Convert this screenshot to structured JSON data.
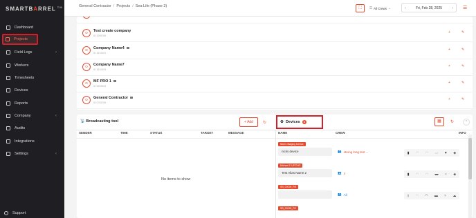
{
  "brand": {
    "part1": "SMART",
    "part2": "B",
    "o": "A",
    "part3": "RREL",
    "tm": "TM"
  },
  "sidebar": {
    "items": [
      {
        "label": "Dashboard",
        "icon": "dashboard-icon"
      },
      {
        "label": "Projects",
        "icon": "projects-icon",
        "active": true
      },
      {
        "label": "Field Logs",
        "icon": "field-logs-icon",
        "chevron": "‹"
      },
      {
        "label": "Workers",
        "icon": "workers-icon"
      },
      {
        "label": "Timesheets",
        "icon": "timesheets-icon"
      },
      {
        "label": "Devices",
        "icon": "devices-icon"
      },
      {
        "label": "Reports",
        "icon": "reports-icon"
      },
      {
        "label": "Company",
        "icon": "company-icon",
        "chevron": "‹"
      },
      {
        "label": "Audits",
        "icon": "audits-icon"
      },
      {
        "label": "Integrations",
        "icon": "integrations-icon"
      },
      {
        "label": "Settings",
        "icon": "settings-icon",
        "chevron": "‹"
      }
    ],
    "support": "Support"
  },
  "topbar": {
    "crumb1": "General Contractor",
    "crumb2": "Projects",
    "crumb3": "Sea Life (Phase 3)",
    "sep": "/",
    "crew_select": "All Crews",
    "date": "Fri, Feb 28, 2025"
  },
  "companies": [
    {
      "name": "Test create company",
      "sub": "ID 2005789"
    },
    {
      "name": "Company Name4",
      "sub": "ID 1512491"
    },
    {
      "name": "Company Name7",
      "sub": "ID 1512493"
    },
    {
      "name": "MF PRO 1",
      "sub": "ID 0002003"
    },
    {
      "name": "General Contractor",
      "sub": "ID 0703789"
    }
  ],
  "broadcast": {
    "title": "Broadcasting tool",
    "add": "+ Add",
    "columns": [
      "SENDER",
      "TIME",
      "STATUS",
      "TARGET",
      "MESSAGE"
    ],
    "empty": "No items to show"
  },
  "devices": {
    "title": "Devices",
    "count": "8",
    "columns": [
      "NAME",
      "CREW",
      "INFO"
    ],
    "rows": [
      {
        "tag": "Nick's Staging Device",
        "name": "nicks device",
        "crew": "strong long test ..."
      },
      {
        "tag": "Michael F UPITHO",
        "name": "Test Alias Name 2",
        "crew": "4"
      },
      {
        "tag": "SB_00026_RS",
        "name": "",
        "crew": "All",
        "crew_blue": true
      },
      {
        "tag": "SB_00026_R2",
        "name": "",
        "crew": ""
      }
    ]
  },
  "colors": {
    "accent": "#e64b2e",
    "highlight": "#d21f2a",
    "sidebar": "#1f1f23"
  }
}
